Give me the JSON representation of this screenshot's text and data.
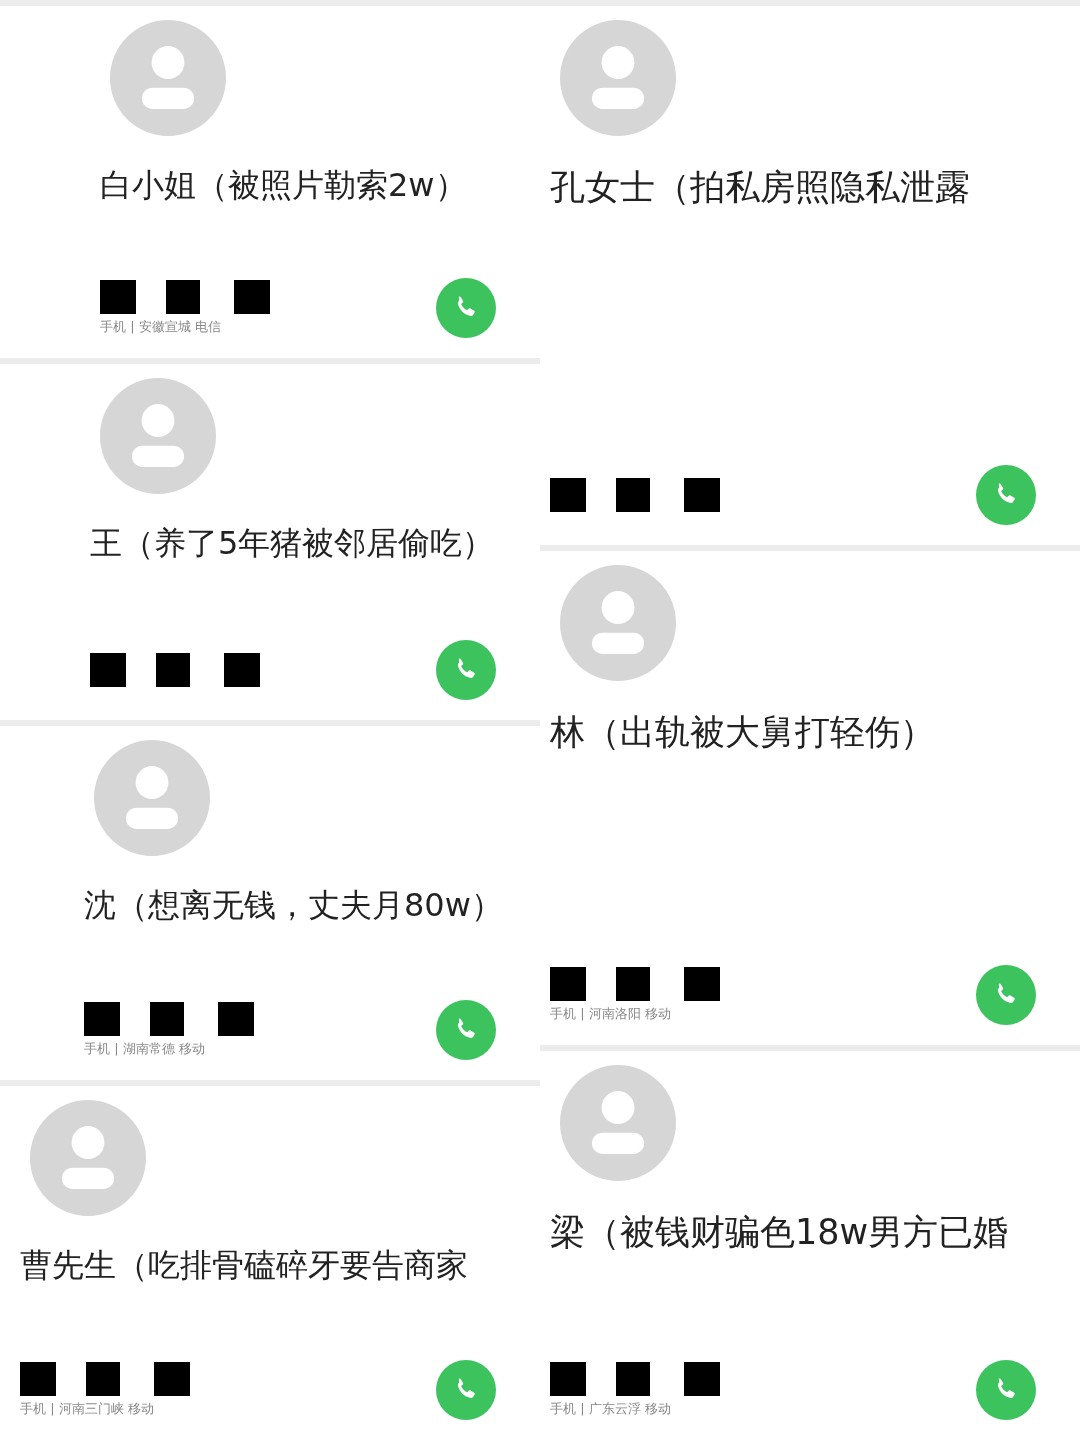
{
  "columns": [
    {
      "cards": [
        {
          "name": "白小姐（被照片勒索2w）",
          "info": "手机 | 安徽宣城 电信"
        },
        {
          "name": "王（养了5年猪被邻居偷吃）"
        },
        {
          "name": "沈（想离无钱，丈夫月80w）",
          "info": "手机 | 湖南常德 移动"
        },
        {
          "name": "曹先生（吃排骨磕碎牙要告商家",
          "info": "手机 | 河南三门峡 移动"
        }
      ]
    },
    {
      "cards": [
        {
          "name": "孔女士（拍私房照隐私泄露"
        },
        {
          "name": "林（出轨被大舅打轻伤）",
          "info": "手机 | 河南洛阳 移动"
        },
        {
          "name": "梁（被钱财骗色18w男方已婚",
          "info": "手机 | 广东云浮 移动"
        }
      ]
    }
  ]
}
